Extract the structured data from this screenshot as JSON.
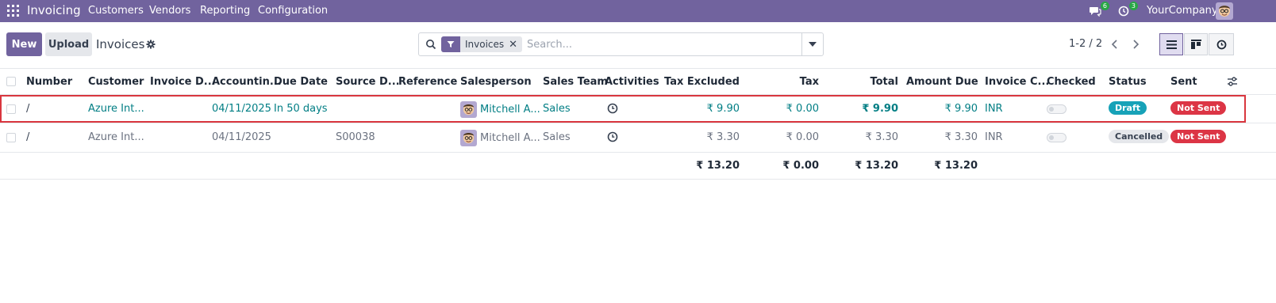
{
  "navbar": {
    "brand": "Invoicing",
    "menu": [
      "Customers",
      "Vendors",
      "Reporting",
      "Configuration"
    ],
    "messages_count": "6",
    "activities_count": "3",
    "company": "YourCompany"
  },
  "control_panel": {
    "new_label": "New",
    "upload_label": "Upload",
    "title": "Invoices",
    "facet_label": "Invoices",
    "search_placeholder": "Search...",
    "pager": "1-2 / 2"
  },
  "table": {
    "headers": [
      "Number",
      "Customer",
      "Invoice D...",
      "Accountin...",
      "Due Date",
      "Source D...",
      "Reference",
      "Salesperson",
      "Sales Team",
      "Activities",
      "Tax Excluded",
      "Tax",
      "Total",
      "Amount Due",
      "Invoice C...",
      "Checked",
      "Status",
      "Sent"
    ],
    "rows": [
      {
        "number": "/",
        "customer": "Azure Int...",
        "invoice_date": "",
        "accounting_date": "04/11/2025",
        "due_date": "In 50 days",
        "source_document": "",
        "reference": "",
        "salesperson": "Mitchell A...",
        "sales_team": "Sales",
        "tax_excluded": "₹ 9.90",
        "tax": "₹ 0.00",
        "total": "₹ 9.90",
        "amount_due": "₹ 9.90",
        "currency": "INR",
        "status": "Draft",
        "sent": "Not Sent"
      },
      {
        "number": "/",
        "customer": "Azure Int...",
        "invoice_date": "",
        "accounting_date": "04/11/2025",
        "due_date": "",
        "source_document": "S00038",
        "reference": "",
        "salesperson": "Mitchell A...",
        "sales_team": "Sales",
        "tax_excluded": "₹ 3.30",
        "tax": "₹ 0.00",
        "total": "₹ 3.30",
        "amount_due": "₹ 3.30",
        "currency": "INR",
        "status": "Cancelled",
        "sent": "Not Sent"
      }
    ],
    "totals": {
      "tax_excluded": "₹ 13.20",
      "tax": "₹ 0.00",
      "total": "₹ 13.20",
      "amount_due": "₹ 13.20"
    }
  },
  "colors": {
    "brand": "#71639e",
    "link": "#017e84",
    "highlight": "#d9363e",
    "draft": "#17a2b8",
    "not_sent": "#dc3545"
  }
}
